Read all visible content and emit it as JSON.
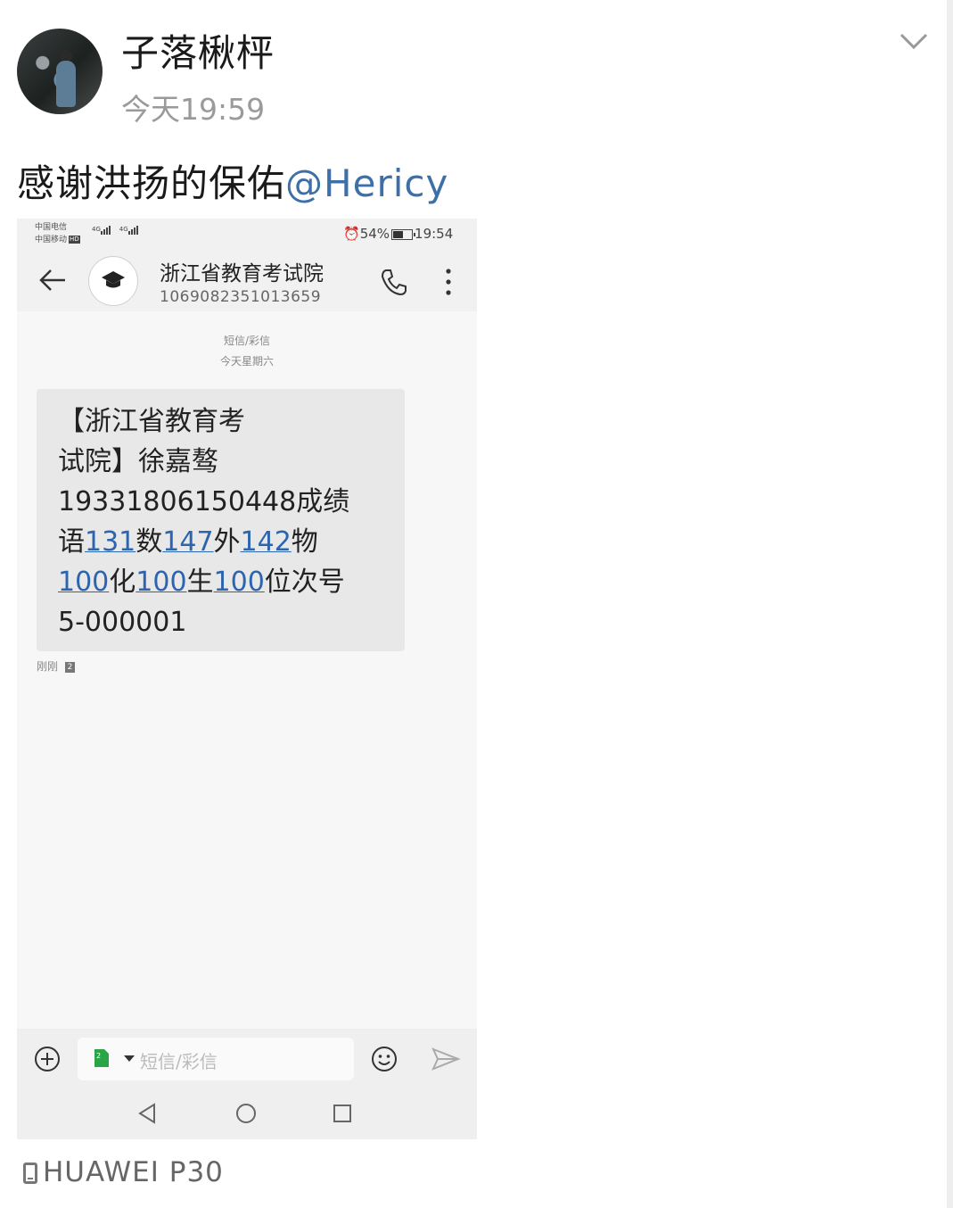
{
  "post": {
    "username": "子落楸枰",
    "timestamp": "今天19:59",
    "text": "感谢洪扬的保佑",
    "mention": "@Hericy",
    "device": "HUAWEI P30"
  },
  "sms_screenshot": {
    "status_bar": {
      "carrier_1": "中国电信",
      "carrier_2": "中国移动",
      "hd_badge": "HD",
      "network_1": "4G",
      "network_2": "4G",
      "battery": "54%",
      "time": "19:54"
    },
    "contact": {
      "name": "浙江省教育考试院",
      "number": "1069082351013659"
    },
    "thread_meta": {
      "type": "短信/彩信",
      "date": "今天星期六"
    },
    "message": {
      "line1": "【浙江省教育考",
      "line2": "试院】徐嘉骜",
      "line3": "19331806150448成绩",
      "l4_a": "语",
      "l4_n1": "131",
      "l4_b": "数",
      "l4_n2": "147",
      "l4_c": "外",
      "l4_n3": "142",
      "l4_d": "物",
      "l5_n1": "100",
      "l5_a": "化",
      "l5_n2": "100",
      "l5_b": "生",
      "l5_n3": "100",
      "l5_c": "位次号",
      "line6": "5-000001",
      "sent_time": "刚刚",
      "sim": "2"
    },
    "composer": {
      "placeholder": "短信/彩信",
      "sim_slot": "2"
    }
  },
  "icons": {
    "post_menu": "chevron-down-icon",
    "back": "arrow-left-icon",
    "contact": "graduation-cap-icon",
    "call": "phone-icon",
    "more": "more-vertical-icon",
    "attach": "plus-circle-icon",
    "emoji": "smiley-icon",
    "send": "send-icon",
    "nav_back": "triangle-back-icon",
    "nav_home": "circle-home-icon",
    "nav_recent": "square-recent-icon",
    "device": "phone-device-icon"
  },
  "colors": {
    "mention": "#3d6fa8",
    "link_number": "#2d64b0",
    "bubble": "#e8e8e8",
    "secondary_text": "#9a9a9a"
  }
}
